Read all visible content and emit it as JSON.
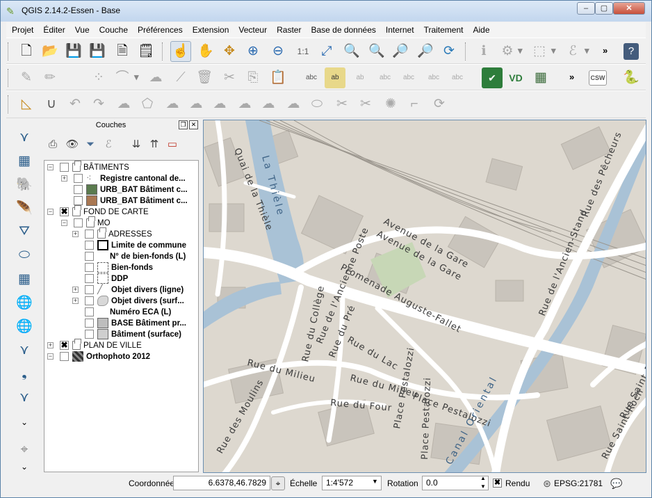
{
  "window": {
    "title": "QGIS 2.14.2-Essen - Base",
    "minimize_glyph": "‒",
    "maximize_glyph": "▢",
    "close_glyph": "✕"
  },
  "menu": [
    "Projet",
    "Éditer",
    "Vue",
    "Couche",
    "Préférences",
    "Extension",
    "Vecteur",
    "Raster",
    "Base de données",
    "Internet",
    "Traitement",
    "Aide"
  ],
  "toolbar_more": "»",
  "layers_panel": {
    "title": "Couches",
    "float_glyph": "❐",
    "close_glyph": "✕",
    "tree": [
      {
        "label": "BÂTIMENTS",
        "bold": false,
        "checked": false,
        "expanded": true,
        "kind": "group",
        "level": 0
      },
      {
        "label": "Registre cantonal de...",
        "bold": true,
        "checked": false,
        "expanded": false,
        "kind": "points",
        "level": 1
      },
      {
        "label": "URB_BAT Bâtiment c...",
        "bold": true,
        "checked": false,
        "kind": "fill",
        "color": "#5b7b4f",
        "level": 1
      },
      {
        "label": "URB_BAT Bâtiment c...",
        "bold": true,
        "checked": false,
        "kind": "fill",
        "color": "#a97752",
        "level": 1
      },
      {
        "label": "FOND DE CARTE",
        "bold": false,
        "checked": true,
        "expanded": true,
        "kind": "group",
        "level": 0
      },
      {
        "label": "MO",
        "bold": false,
        "checked": false,
        "expanded": true,
        "kind": "group",
        "level": 1
      },
      {
        "label": "ADRESSES",
        "bold": false,
        "checked": false,
        "expanded": false,
        "kind": "group",
        "level": 2
      },
      {
        "label": "Limite de commune",
        "bold": true,
        "checked": false,
        "kind": "outline",
        "level": 2
      },
      {
        "label": "N° de bien-fonds (L)",
        "bold": true,
        "checked": false,
        "kind": "none",
        "level": 2
      },
      {
        "label": "Bien-fonds",
        "bold": true,
        "checked": false,
        "kind": "dashed",
        "level": 2
      },
      {
        "label": "DDP",
        "bold": true,
        "checked": false,
        "kind": "dashed",
        "level": 2
      },
      {
        "label": "Objet divers (ligne)",
        "bold": true,
        "checked": false,
        "expanded": false,
        "kind": "line",
        "level": 2
      },
      {
        "label": "Objet divers (surf...",
        "bold": true,
        "checked": false,
        "expanded": false,
        "kind": "blob",
        "level": 2
      },
      {
        "label": "Numéro ECA (L)",
        "bold": true,
        "checked": false,
        "kind": "none",
        "level": 2
      },
      {
        "label": "BASE Bâtiment pr...",
        "bold": true,
        "checked": false,
        "kind": "fill",
        "color": "#bdbdbd",
        "level": 2
      },
      {
        "label": "Bâtiment (surface)",
        "bold": true,
        "checked": false,
        "kind": "fill",
        "color": "#cfcfcf",
        "level": 2
      },
      {
        "label": "PLAN DE VILLE",
        "bold": false,
        "checked": true,
        "expanded": false,
        "kind": "group",
        "level": 0
      },
      {
        "label": "Orthophoto 2012",
        "bold": true,
        "checked": false,
        "expanded": true,
        "kind": "raster",
        "level": 0
      }
    ]
  },
  "map_labels": {
    "quai_thiele": "Quai de la Thièle",
    "la_thiele": "La Thièle",
    "avenue_gare_1": "Avenue de la Gare",
    "avenue_gare_2": "Avenue de la Gare",
    "ancien_stand": "Rue de l'Ancien-Stand",
    "pecheurs": "Rue des Pêcheurs",
    "promenade": "Promenade Auguste-Fallet",
    "ancienne_poste": "Rue de l'Ancienne Poste",
    "college": "Rue du Collège",
    "rue_pre": "Rue du Pré",
    "rue_lac": "Rue du Lac",
    "milieu_1": "Rue du Milieu",
    "milieu_2": "Rue du Milieu",
    "rue_four": "Rue du Four",
    "moulins": "Rue des Moulins",
    "place_pestalozzi_1": "Place Pestalozzi",
    "place_pestalozzi_2": "Place Pestalozzi",
    "place_pestalozzi_3": "Place Pestalozzi",
    "canal": "Canal Oriental",
    "saint_roch": "Rue Saint-Roch",
    "rue_saint_roch": "Rue Saint-Roch"
  },
  "status_bar": {
    "coord_label": "Coordonnée",
    "coord_value": "6.6378,46.7829",
    "scale_label": "Échelle",
    "scale_value": "1:4'572",
    "rotation_label": "Rotation",
    "rotation_value": "0.0",
    "render_label": "Rendu",
    "render_checked": true,
    "crs": "EPSG:21781"
  },
  "colors": {
    "map_bg": "#ddd8cf",
    "water": "#a9c2d6",
    "road": "#ffffff",
    "building": "#c4bfb7",
    "park": "#c7d7b6"
  }
}
